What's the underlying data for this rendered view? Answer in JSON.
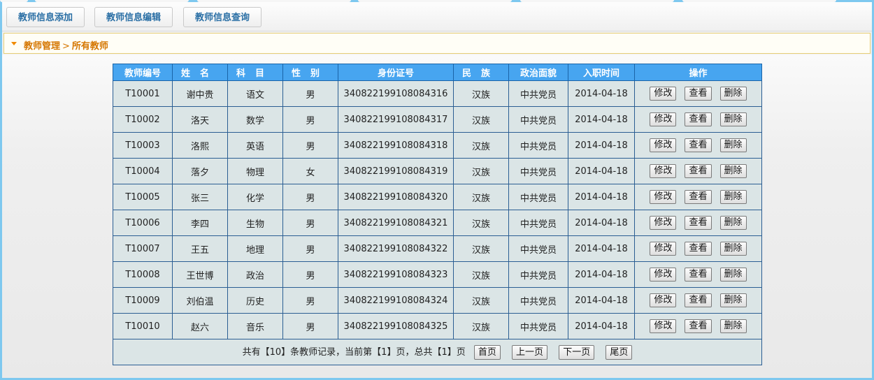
{
  "toolbar": {
    "add_label": "教师信息添加",
    "edit_label": "教师信息编辑",
    "query_label": "教师信息查询"
  },
  "breadcrumb": {
    "section": "教师管理",
    "separator": ">",
    "current": "所有教师"
  },
  "table": {
    "headers": {
      "id": "教师编号",
      "name": "姓名",
      "subject": "科目",
      "gender": "性别",
      "idcard": "身份证号",
      "ethnicity": "民族",
      "politics": "政治面貌",
      "hiredate": "入职时间",
      "actions": "操作"
    },
    "action_labels": {
      "edit": "修改",
      "view": "查看",
      "delete": "删除"
    },
    "rows": [
      {
        "id": "T10001",
        "name": "谢中贵",
        "subject": "语文",
        "gender": "男",
        "idcard": "340822199108084316",
        "ethnicity": "汉族",
        "politics": "中共党员",
        "hiredate": "2014-04-18"
      },
      {
        "id": "T10002",
        "name": "洛天",
        "subject": "数学",
        "gender": "男",
        "idcard": "340822199108084317",
        "ethnicity": "汉族",
        "politics": "中共党员",
        "hiredate": "2014-04-18"
      },
      {
        "id": "T10003",
        "name": "洛熙",
        "subject": "英语",
        "gender": "男",
        "idcard": "340822199108084318",
        "ethnicity": "汉族",
        "politics": "中共党员",
        "hiredate": "2014-04-18"
      },
      {
        "id": "T10004",
        "name": "落夕",
        "subject": "物理",
        "gender": "女",
        "idcard": "340822199108084319",
        "ethnicity": "汉族",
        "politics": "中共党员",
        "hiredate": "2014-04-18"
      },
      {
        "id": "T10005",
        "name": "张三",
        "subject": "化学",
        "gender": "男",
        "idcard": "340822199108084320",
        "ethnicity": "汉族",
        "politics": "中共党员",
        "hiredate": "2014-04-18"
      },
      {
        "id": "T10006",
        "name": "李四",
        "subject": "生物",
        "gender": "男",
        "idcard": "340822199108084321",
        "ethnicity": "汉族",
        "politics": "中共党员",
        "hiredate": "2014-04-18"
      },
      {
        "id": "T10007",
        "name": "王五",
        "subject": "地理",
        "gender": "男",
        "idcard": "340822199108084322",
        "ethnicity": "汉族",
        "politics": "中共党员",
        "hiredate": "2014-04-18"
      },
      {
        "id": "T10008",
        "name": "王世博",
        "subject": "政治",
        "gender": "男",
        "idcard": "340822199108084323",
        "ethnicity": "汉族",
        "politics": "中共党员",
        "hiredate": "2014-04-18"
      },
      {
        "id": "T10009",
        "name": "刘伯温",
        "subject": "历史",
        "gender": "男",
        "idcard": "340822199108084324",
        "ethnicity": "汉族",
        "politics": "中共党员",
        "hiredate": "2014-04-18"
      },
      {
        "id": "T10010",
        "name": "赵六",
        "subject": "音乐",
        "gender": "男",
        "idcard": "340822199108084325",
        "ethnicity": "汉族",
        "politics": "中共党员",
        "hiredate": "2014-04-18"
      }
    ]
  },
  "pager": {
    "summary": "共有【10】条教师记录，当前第【1】页，总共【1】页",
    "first": "首页",
    "prev": "上一页",
    "next": "下一页",
    "last": "尾页"
  },
  "colors": {
    "header_bg": "#47a5f0",
    "cell_bg": "#dbe5e6",
    "breadcrumb_text": "#d57600",
    "toolbar_text": "#2a6fa5"
  }
}
